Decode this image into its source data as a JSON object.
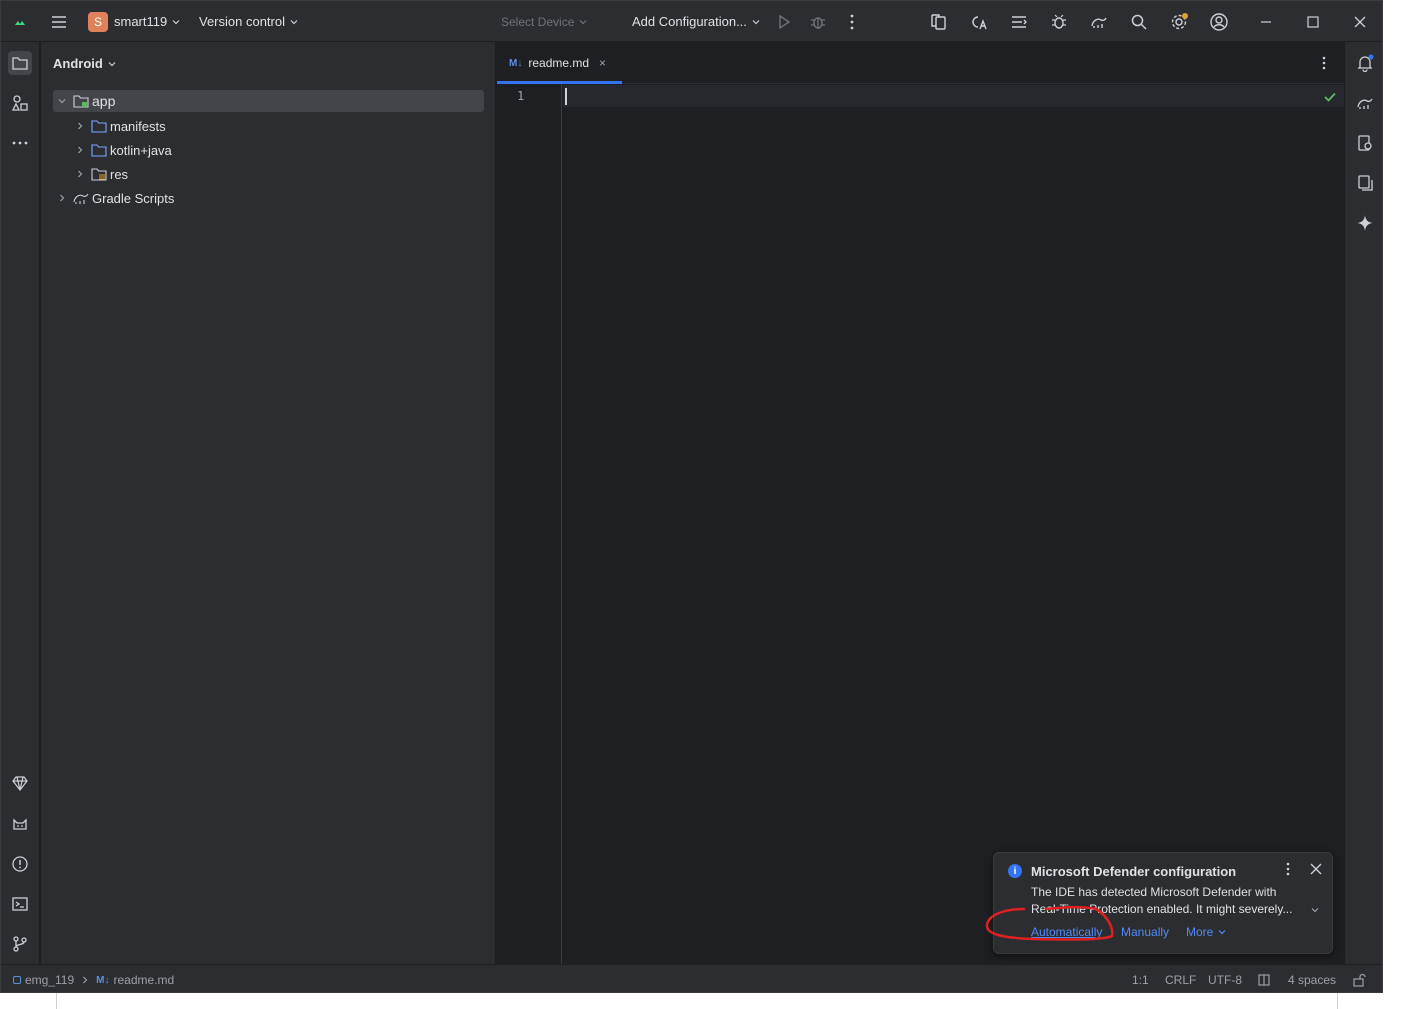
{
  "titlebar": {
    "project_initial": "S",
    "project_name": "smart119",
    "vcs_label": "Version control",
    "device_placeholder": "Select Device",
    "config_label": "Add Configuration..."
  },
  "project_panel": {
    "view_label": "Android",
    "tree": [
      {
        "label": "app",
        "level": 0,
        "expanded": true,
        "selected": true
      },
      {
        "label": "manifests",
        "level": 1,
        "expanded": false
      },
      {
        "label": "kotlin+java",
        "level": 1,
        "expanded": false
      },
      {
        "label": "res",
        "level": 1,
        "expanded": false
      },
      {
        "label": "Gradle Scripts",
        "level": 0,
        "expanded": false
      }
    ]
  },
  "editor": {
    "tab_badge": "M↓",
    "tab_label": "readme.md",
    "tab_close": "×",
    "line_number": "1"
  },
  "statusbar": {
    "module": "emg_119",
    "file_badge": "M↓",
    "file": "readme.md",
    "position": "1:1",
    "line_separator": "CRLF",
    "encoding": "UTF-8",
    "indent": "4 spaces"
  },
  "notification": {
    "title": "Microsoft Defender configuration",
    "body_line1": "The IDE has detected Microsoft Defender with",
    "body_line2": "Real-Time Protection enabled. It might severely...",
    "action_auto": "Automatically",
    "action_manual": "Manually",
    "action_more": "More",
    "info_glyph": "i"
  },
  "colors": {
    "accent": "#3574f0",
    "link": "#548af7",
    "annotation": "#e02020"
  }
}
